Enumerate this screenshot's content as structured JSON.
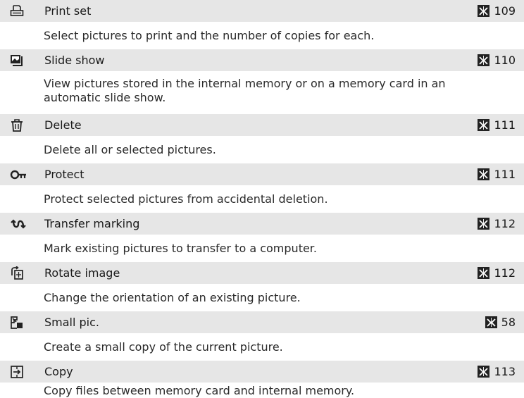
{
  "entries": [
    {
      "icon": "print-set-icon",
      "title": "Print set",
      "page": "109",
      "description": "Select pictures to print and the number of copies for each."
    },
    {
      "icon": "slide-show-icon",
      "title": "Slide show",
      "page": "110",
      "description": "View pictures stored in the internal memory or on a memory card in an automatic slide show."
    },
    {
      "icon": "delete-icon",
      "title": "Delete",
      "page": "111",
      "description": "Delete all or selected pictures."
    },
    {
      "icon": "protect-icon",
      "title": "Protect",
      "page": "111",
      "description": "Protect selected pictures from accidental deletion."
    },
    {
      "icon": "transfer-marking-icon",
      "title": "Transfer marking",
      "page": "112",
      "description": "Mark existing pictures to transfer to a computer."
    },
    {
      "icon": "rotate-image-icon",
      "title": "Rotate image",
      "page": "112",
      "description": "Change the orientation of an existing picture."
    },
    {
      "icon": "small-pic-icon",
      "title": "Small pic.",
      "page": "58",
      "description": "Create a small copy of the current picture."
    },
    {
      "icon": "copy-icon",
      "title": "Copy",
      "page": "113",
      "description": "Copy files between memory card and internal memory."
    }
  ],
  "colors": {
    "row_background": "#e6e6e6",
    "text": "#1a1a1a"
  }
}
